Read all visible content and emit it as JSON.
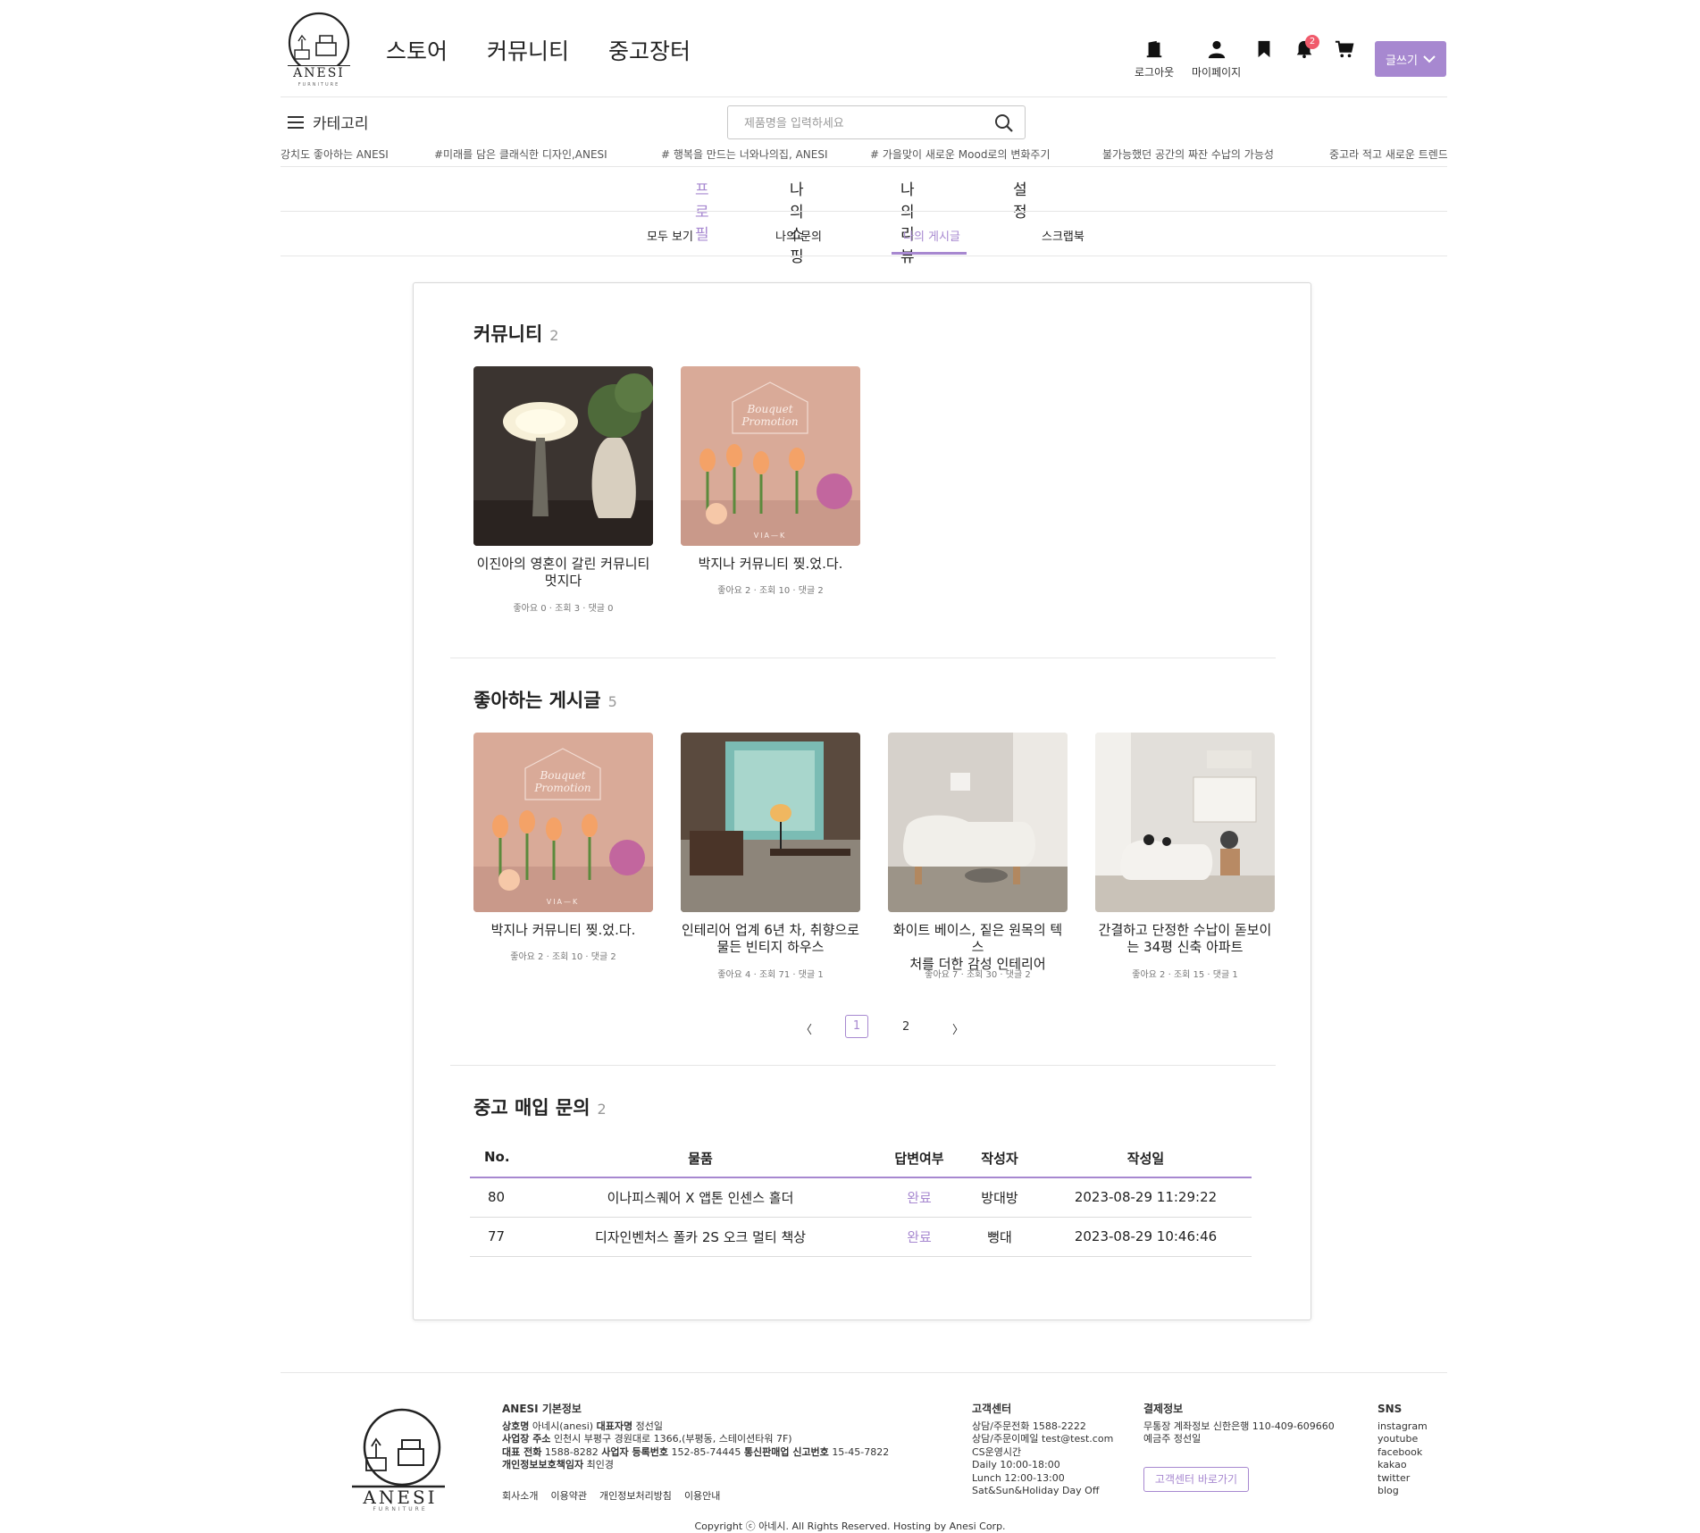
{
  "brand": {
    "name": "ANESI",
    "sub": "FURNITURE"
  },
  "nav": {
    "store": "스토어",
    "community": "커뮤니티",
    "used": "중고장터"
  },
  "header": {
    "logout": "로그아웃",
    "mypage": "마이페이지",
    "notification_count": "2",
    "write_label": "글쓰기",
    "accent_color": "#a788d0"
  },
  "category_label": "카테고리",
  "search": {
    "placeholder": "제품명을 입력하세요"
  },
  "ticker": [
    "강치도 좋아하는 ANESI",
    "#미래를 담은 클래식한 디자인,ANESI",
    "# 행복을 만드는 너와나의집, ANESI",
    "# 가을맞이 새로운 Mood로의 변화주기",
    "불가능했던 공간의 짜잔 수납의 가능성",
    "중고라 적고 새로운 트렌드라"
  ],
  "profile_tabs": [
    "프로필",
    "나의 쇼핑",
    "나의 리뷰",
    "설정"
  ],
  "sub_tabs": [
    "모두 보기",
    "나의 문의",
    "나의 게시글",
    "스크랩북"
  ],
  "community": {
    "title": "커뮤니티",
    "count": "2",
    "posts": [
      {
        "title_line1": "이진아의 영혼이 갈린 커뮤니티",
        "title_line2": "멋지다",
        "meta": "좋아요 0 · 조회 3 · 댓글 0"
      },
      {
        "title_line1": "박지나 커뮤니티 찢.었.다.",
        "title_line2": "",
        "meta": "좋아요 2 · 조회 10 · 댓글 2"
      }
    ]
  },
  "liked": {
    "title": "좋아하는 게시글",
    "count": "5",
    "posts": [
      {
        "title_line1": "박지나 커뮤니티 찢.었.다.",
        "title_line2": "",
        "meta": "좋아요 2 · 조회 10 · 댓글 2"
      },
      {
        "title_line1": "인테리어 업계 6년 차, 취향으로",
        "title_line2": "물든 빈티지 하우스",
        "meta": "좋아요 4 · 조회 71 · 댓글 1"
      },
      {
        "title_line1": "화이트 베이스, 짙은 원목의 텍스",
        "title_line2": "처를 더한 감성 인테리어",
        "meta": "좋아요 7 · 조회 30 · 댓글 2"
      },
      {
        "title_line1": "간결하고 단정한 수납이 돋보이",
        "title_line2": "는 34평 신축 아파트",
        "meta": "좋아요 2 · 조회 15 · 댓글 1"
      }
    ],
    "bouquet_line1": "Bouquet",
    "bouquet_line2": "Promotion",
    "bouquet_brand": "VIA—K"
  },
  "pagination": {
    "prev": "〈",
    "pages": [
      "1",
      "2"
    ],
    "next": "〉",
    "current": "1"
  },
  "inquiry": {
    "title": "중고 매입 문의",
    "count": "2",
    "headers": [
      "No.",
      "물품",
      "답변여부",
      "작성자",
      "작성일"
    ],
    "rows": [
      {
        "no": "80",
        "item": "이나피스퀘어 X 앱톤 인센스 홀더",
        "status": "완료",
        "writer": "방대방",
        "date": "2023-08-29 11:29:22"
      },
      {
        "no": "77",
        "item": "디자인벤처스 폴카 2S 오크 멀티 책상",
        "status": "완료",
        "writer": "뻥대",
        "date": "2023-08-29 10:46:46"
      }
    ]
  },
  "footer": {
    "info_title": "ANESI 기본정보",
    "line1_k1": "상호명",
    "line1_v1": "아네시(anesi)",
    "line1_k2": "대표자명",
    "line1_v2": "정선일",
    "line2_k": "사업장 주소",
    "line2_v": "인천시 부평구 경원대로 1366,(부평동, 스테이션타워 7F)",
    "line3_k1": "대표 전화",
    "line3_v1": "1588-8282",
    "line3_k2": "사업자 등록번호",
    "line3_v2": "152-85-74445",
    "line3_k3": "통신판매업 신고번호",
    "line3_v3": "15-45-7822",
    "line4_k": "개인정보보호책임자",
    "line4_v": "최인경",
    "links": [
      "회사소개",
      "이용약관",
      "개인정보처리방침",
      "이용안내"
    ],
    "cs_title": "고객센터",
    "cs_lines": [
      "상담/주문전화 1588-2222",
      "상담/주문이메일 test@test.com",
      "CS운영시간",
      "Daily 10:00-18:00",
      "Lunch 12:00-13:00",
      "Sat&Sun&Holiday Day Off"
    ],
    "pay_title": "결제정보",
    "pay_lines": [
      "무통장 계좌정보 신한은행 110-409-609660",
      "예금주 정선일"
    ],
    "cs_button": "고객센터 바로가기",
    "sns_title": "SNS",
    "sns": [
      "instagram",
      "youtube",
      "facebook",
      "kakao",
      "twitter",
      "blog"
    ],
    "copyright": "Copyright ⓒ 아네시. All Rights Reserved. Hosting by Anesi Corp."
  }
}
